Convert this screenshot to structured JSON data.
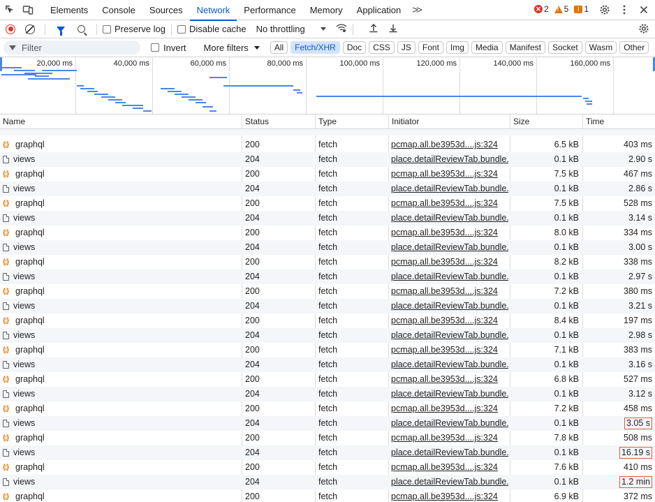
{
  "tabs": {
    "items": [
      "Elements",
      "Console",
      "Sources",
      "Network",
      "Performance",
      "Memory",
      "Application"
    ],
    "active": "Network",
    "more": ">>"
  },
  "counters": {
    "errors": "2",
    "warnings": "5",
    "issues": "1"
  },
  "toolbar": {
    "preserve_log": "Preserve log",
    "disable_cache": "Disable cache",
    "throttling": "No throttling"
  },
  "filterbar": {
    "placeholder": "Filter",
    "invert": "Invert",
    "more_filters": "More filters",
    "chips": [
      "All",
      "Fetch/XHR",
      "Doc",
      "CSS",
      "JS",
      "Font",
      "Img",
      "Media",
      "Manifest",
      "Socket",
      "Wasm",
      "Other"
    ],
    "active_chip": "Fetch/XHR"
  },
  "overview": {
    "ticks": [
      "20,000 ms",
      "40,000 ms",
      "60,000 ms",
      "80,000 ms",
      "100,000 ms",
      "120,000 ms",
      "140,000 ms",
      "160,000 ms"
    ]
  },
  "columns": {
    "name": "Name",
    "status": "Status",
    "type": "Type",
    "initiator": "Initiator",
    "size": "Size",
    "time": "Time"
  },
  "rows": [
    {
      "name": "graphql",
      "icon": "graphql-icon",
      "status": "200",
      "type": "fetch",
      "initiator": "pcmap.all.be3953d....js:324",
      "size": "6.5 kB",
      "time": "403 ms",
      "highlight": false
    },
    {
      "name": "views",
      "icon": "document-icon",
      "status": "204",
      "type": "fetch",
      "initiator": "place.detailReviewTab.bundle.",
      "size": "0.1 kB",
      "time": "2.90 s",
      "highlight": false
    },
    {
      "name": "graphql",
      "icon": "graphql-icon",
      "status": "200",
      "type": "fetch",
      "initiator": "pcmap.all.be3953d....js:324",
      "size": "7.5 kB",
      "time": "467 ms",
      "highlight": false
    },
    {
      "name": "views",
      "icon": "document-icon",
      "status": "204",
      "type": "fetch",
      "initiator": "place.detailReviewTab.bundle.",
      "size": "0.1 kB",
      "time": "2.86 s",
      "highlight": false
    },
    {
      "name": "graphql",
      "icon": "graphql-icon",
      "status": "200",
      "type": "fetch",
      "initiator": "pcmap.all.be3953d....js:324",
      "size": "7.5 kB",
      "time": "528 ms",
      "highlight": false
    },
    {
      "name": "views",
      "icon": "document-icon",
      "status": "204",
      "type": "fetch",
      "initiator": "place.detailReviewTab.bundle.",
      "size": "0.1 kB",
      "time": "3.14 s",
      "highlight": false
    },
    {
      "name": "graphql",
      "icon": "graphql-icon",
      "status": "200",
      "type": "fetch",
      "initiator": "pcmap.all.be3953d....js:324",
      "size": "8.0 kB",
      "time": "334 ms",
      "highlight": false
    },
    {
      "name": "views",
      "icon": "document-icon",
      "status": "204",
      "type": "fetch",
      "initiator": "place.detailReviewTab.bundle.",
      "size": "0.1 kB",
      "time": "3.00 s",
      "highlight": false
    },
    {
      "name": "graphql",
      "icon": "graphql-icon",
      "status": "200",
      "type": "fetch",
      "initiator": "pcmap.all.be3953d....js:324",
      "size": "8.2 kB",
      "time": "338 ms",
      "highlight": false
    },
    {
      "name": "views",
      "icon": "document-icon",
      "status": "204",
      "type": "fetch",
      "initiator": "place.detailReviewTab.bundle.",
      "size": "0.1 kB",
      "time": "2.97 s",
      "highlight": false
    },
    {
      "name": "graphql",
      "icon": "graphql-icon",
      "status": "200",
      "type": "fetch",
      "initiator": "pcmap.all.be3953d....js:324",
      "size": "7.2 kB",
      "time": "380 ms",
      "highlight": false
    },
    {
      "name": "views",
      "icon": "document-icon",
      "status": "204",
      "type": "fetch",
      "initiator": "place.detailReviewTab.bundle.",
      "size": "0.1 kB",
      "time": "3.21 s",
      "highlight": false
    },
    {
      "name": "graphql",
      "icon": "graphql-icon",
      "status": "200",
      "type": "fetch",
      "initiator": "pcmap.all.be3953d....js:324",
      "size": "8.4 kB",
      "time": "197 ms",
      "highlight": false
    },
    {
      "name": "views",
      "icon": "document-icon",
      "status": "204",
      "type": "fetch",
      "initiator": "place.detailReviewTab.bundle.",
      "size": "0.1 kB",
      "time": "2.98 s",
      "highlight": false
    },
    {
      "name": "graphql",
      "icon": "graphql-icon",
      "status": "200",
      "type": "fetch",
      "initiator": "pcmap.all.be3953d....js:324",
      "size": "7.1 kB",
      "time": "383 ms",
      "highlight": false
    },
    {
      "name": "views",
      "icon": "document-icon",
      "status": "204",
      "type": "fetch",
      "initiator": "place.detailReviewTab.bundle.",
      "size": "0.1 kB",
      "time": "3.16 s",
      "highlight": false
    },
    {
      "name": "graphql",
      "icon": "graphql-icon",
      "status": "200",
      "type": "fetch",
      "initiator": "pcmap.all.be3953d....js:324",
      "size": "6.8 kB",
      "time": "527 ms",
      "highlight": false
    },
    {
      "name": "views",
      "icon": "document-icon",
      "status": "204",
      "type": "fetch",
      "initiator": "place.detailReviewTab.bundle.",
      "size": "0.1 kB",
      "time": "3.12 s",
      "highlight": false
    },
    {
      "name": "graphql",
      "icon": "graphql-icon",
      "status": "200",
      "type": "fetch",
      "initiator": "pcmap.all.be3953d....js:324",
      "size": "7.2 kB",
      "time": "458 ms",
      "highlight": false
    },
    {
      "name": "views",
      "icon": "document-icon",
      "status": "204",
      "type": "fetch",
      "initiator": "place.detailReviewTab.bundle.",
      "size": "0.1 kB",
      "time": "3.05 s",
      "highlight": true
    },
    {
      "name": "graphql",
      "icon": "graphql-icon",
      "status": "200",
      "type": "fetch",
      "initiator": "pcmap.all.be3953d....js:324",
      "size": "7.8 kB",
      "time": "508 ms",
      "highlight": false
    },
    {
      "name": "views",
      "icon": "document-icon",
      "status": "204",
      "type": "fetch",
      "initiator": "place.detailReviewTab.bundle.",
      "size": "0.1 kB",
      "time": "16.19 s",
      "highlight": true
    },
    {
      "name": "graphql",
      "icon": "graphql-icon",
      "status": "200",
      "type": "fetch",
      "initiator": "pcmap.all.be3953d....js:324",
      "size": "7.6 kB",
      "time": "410 ms",
      "highlight": false
    },
    {
      "name": "views",
      "icon": "document-icon",
      "status": "204",
      "type": "fetch",
      "initiator": "place.detailReviewTab.bundle.",
      "size": "0.1 kB",
      "time": "1.2 min",
      "highlight": true
    },
    {
      "name": "graphql",
      "icon": "graphql-icon",
      "status": "200",
      "type": "fetch",
      "initiator": "pcmap.all.be3953d....js:324",
      "size": "6.9 kB",
      "time": "372 ms",
      "highlight": false
    }
  ],
  "colors": {
    "accent": "#0b57d0",
    "error": "#dc362e",
    "warning": "#e37400",
    "highlight_box": "#e05a46",
    "waterfall": "#4a86e8"
  }
}
